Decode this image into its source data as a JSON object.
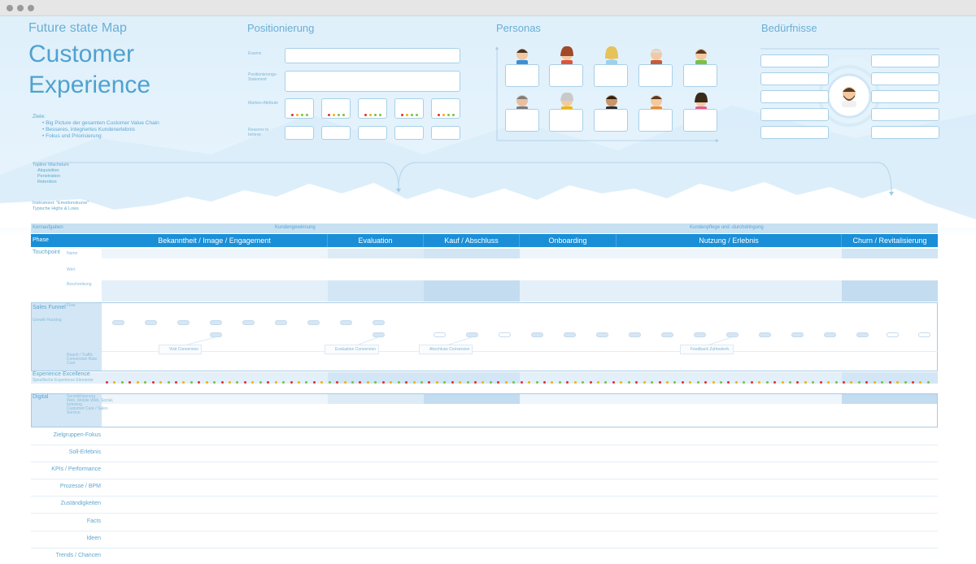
{
  "header": {
    "map_title": "Future state Map",
    "main_title_line1": "Customer",
    "main_title_line2": "Experience",
    "goals_label": "Ziele:",
    "goals": [
      "Big Picture der gesamten Customer Value Chain",
      "Besseres, integriertes Kundenerlebnis",
      "Fokus und Priorisierung"
    ],
    "topline_label": "Topline Wachstum",
    "topline_items": [
      "Akquisition",
      "Penetration",
      "Retention"
    ],
    "instrument_lines": [
      "Instrument: \"Emotionskurve\"",
      "Typische Highs & Lows"
    ]
  },
  "positionierung": {
    "title": "Positionierung",
    "fields": [
      "Essenz",
      "Positionierungs-Statement",
      "Marken-Attribute",
      "Reasons to believe"
    ]
  },
  "personas": {
    "title": "Personas"
  },
  "beduerfnisse": {
    "title": "Bedürfnisse"
  },
  "grid": {
    "band_left": "Kernaufgaben",
    "band_mid": "Kundengewinnung",
    "band_right": "Kundenpflege und -durchdringung",
    "phase_label": "Phase",
    "phases": [
      "Bekanntheit / Image / Engagement",
      "Evaluation",
      "Kauf / Abschluss",
      "Onboarding",
      "Nutzung / Erlebnis",
      "Churn / Revitalisierung"
    ],
    "rows": {
      "touchpoint": "Touchpoint",
      "touchpoint_sub": [
        "Name",
        "Wert",
        "Beschreibung"
      ],
      "sales_funnel": "Sales Funnel",
      "sales_funnel_sub": "Growth Hacking",
      "flow": "Flow",
      "flow_sub": [
        "Reach / Traffic",
        "Conversion Rate",
        "Cost"
      ],
      "experience": "Experience Excellence",
      "experience_sub": "Spezifische Experience Elemente",
      "digital": "Digital",
      "digital_sub": [
        "Sensibilisierung",
        "Web, Mobile Web, Social,",
        "Indexing",
        "Customer Care / Sales",
        "Service"
      ]
    },
    "conversions": [
      "Visit Conversion",
      "Evaluation Conversion",
      "Abschluss Conversion",
      "Feedback Zufriedenh."
    ],
    "lower_rows": [
      "Zielgruppen-Fokus",
      "Soll-Erlebnis",
      "KPIs / Performance",
      "Prozesse / BPM",
      "Zuständigkeiten",
      "Facts",
      "Ideen",
      "Trends / Chancen"
    ]
  },
  "colors": {
    "accent": "#1a8fd8",
    "title": "#4fa2d0",
    "band": "#b9d9ef",
    "rating_dots": [
      "#e03030",
      "#f0b400",
      "#7ac143"
    ]
  }
}
